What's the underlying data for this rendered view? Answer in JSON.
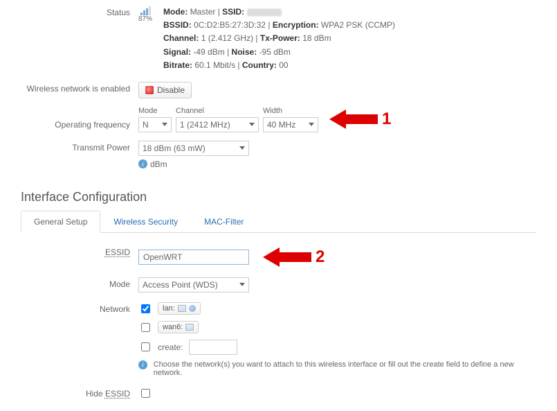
{
  "status": {
    "label": "Status",
    "signal_pct": "87%",
    "mode_label": "Mode:",
    "mode": "Master",
    "ssid_label": "SSID:",
    "bssid_label": "BSSID:",
    "bssid": "0C:D2:B5:27:3D:32",
    "encryption_label": "Encryption:",
    "encryption": "WPA2 PSK (CCMP)",
    "channel_label": "Channel:",
    "channel": "1 (2.412 GHz)",
    "txpower_label": "Tx-Power:",
    "txpower": "18 dBm",
    "signal_label": "Signal:",
    "signal": "-49 dBm",
    "noise_label": "Noise:",
    "noise": "-95 dBm",
    "bitrate_label": "Bitrate:",
    "bitrate": "60.1 Mbit/s",
    "country_label": "Country:",
    "country": "00"
  },
  "enable": {
    "label": "Wireless network is enabled",
    "button": "Disable"
  },
  "freq": {
    "label": "Operating frequency",
    "mode_label": "Mode",
    "mode": "N",
    "channel_label": "Channel",
    "channel": "1 (2412 MHz)",
    "width_label": "Width",
    "width": "40 MHz",
    "anno": "1"
  },
  "tx": {
    "label": "Transmit Power",
    "value": "18 dBm (63 mW)",
    "hint": "dBm"
  },
  "iface": {
    "heading": "Interface Configuration",
    "tabs": {
      "general": "General Setup",
      "security": "Wireless Security",
      "mac": "MAC-Filter"
    },
    "essid_label": "ESSID",
    "essid_value": "OpenWRT",
    "essid_anno": "2",
    "mode_label": "Mode",
    "mode_value": "Access Point (WDS)",
    "network_label": "Network",
    "net_items": {
      "lan": "lan:",
      "wan6": "wan6:",
      "create": "create:"
    },
    "network_hint": "Choose the network(s) you want to attach to this wireless interface or fill out the create field to define a new network.",
    "hide_label": "Hide ESSID"
  }
}
